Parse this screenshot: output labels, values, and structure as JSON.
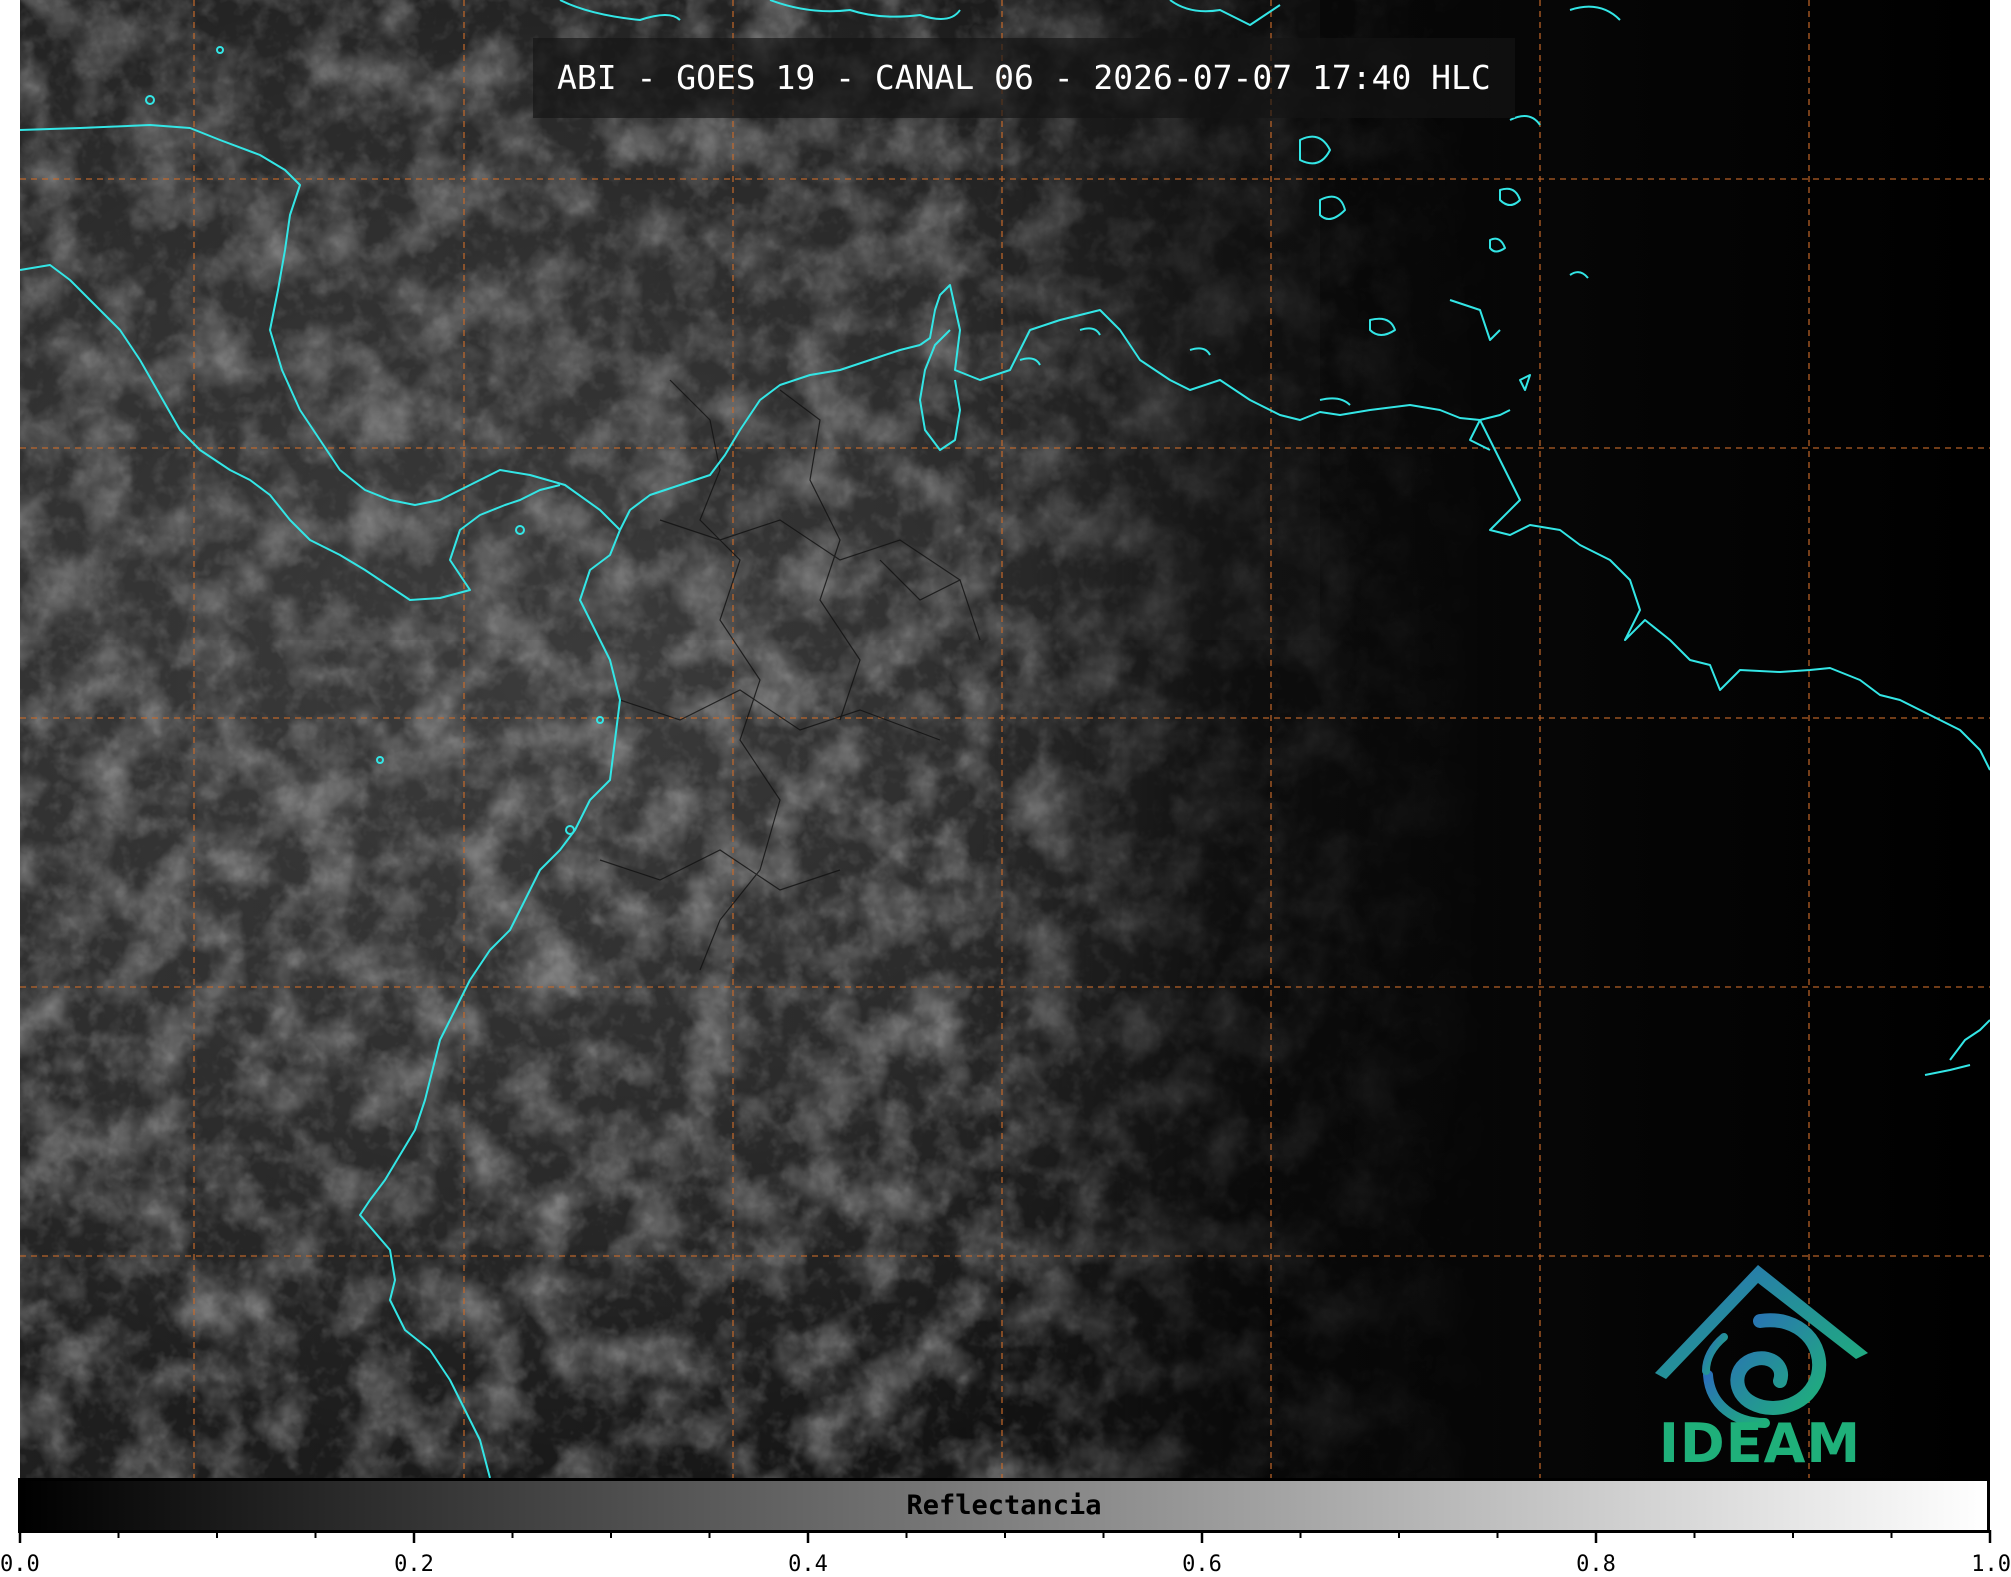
{
  "title": "ABI - GOES 19 - CANAL 06 - 2026-07-07 17:40 HLC",
  "colorbar": {
    "label": "Reflectancia",
    "min": 0.0,
    "max": 1.0,
    "tick_labels": [
      "0.0",
      "0.2",
      "0.4",
      "0.6",
      "0.8",
      "1.0"
    ],
    "tick_values": [
      0.0,
      0.2,
      0.4,
      0.6,
      0.8,
      1.0
    ],
    "minor_tick_values": [
      0.05,
      0.1,
      0.15,
      0.25,
      0.3,
      0.35,
      0.45,
      0.5,
      0.55,
      0.65,
      0.7,
      0.75,
      0.85,
      0.9,
      0.95
    ],
    "gradient_start": "#000000",
    "gradient_end": "#ffffff"
  },
  "logo": {
    "text": "IDEAM",
    "icon": "ideam-spiral-logo",
    "colors": [
      "#2a6fb8",
      "#1fb07a"
    ]
  },
  "map": {
    "coastline_color": "#33e6e6",
    "graticule_color": "#c86a2a",
    "background": "#000000"
  }
}
